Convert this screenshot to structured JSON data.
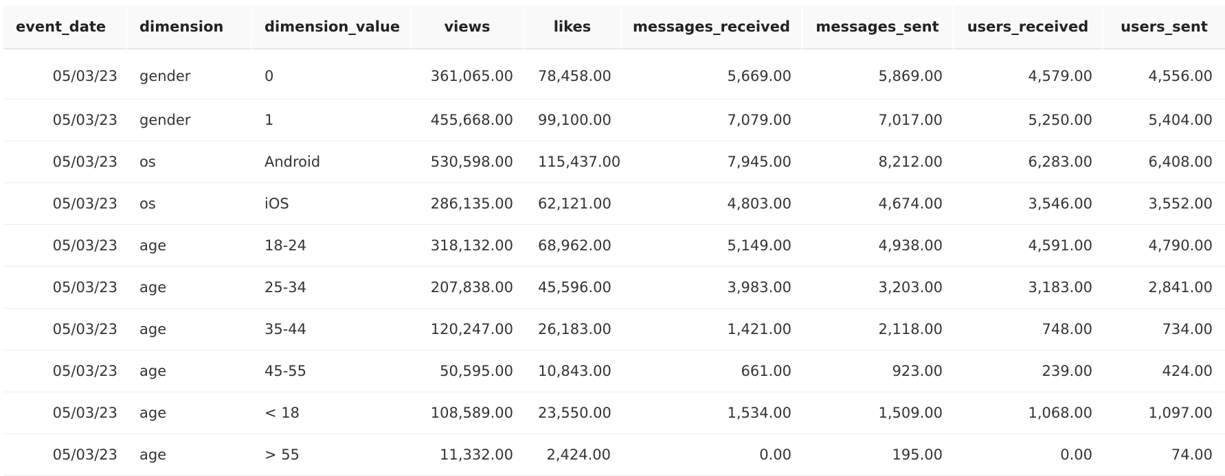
{
  "table": {
    "columns": [
      {
        "key": "event_date",
        "label": "event_date"
      },
      {
        "key": "dimension",
        "label": "dimension"
      },
      {
        "key": "dimension_value",
        "label": "dimension_value"
      },
      {
        "key": "views",
        "label": "views"
      },
      {
        "key": "likes",
        "label": "likes"
      },
      {
        "key": "messages_received",
        "label": "messages_received"
      },
      {
        "key": "messages_sent",
        "label": "messages_sent"
      },
      {
        "key": "users_received",
        "label": "users_received"
      },
      {
        "key": "users_sent",
        "label": "users_sent"
      }
    ],
    "rows": [
      [
        "05/03/23",
        "gender",
        "0",
        "361,065.00",
        "78,458.00",
        "5,669.00",
        "5,869.00",
        "4,579.00",
        "4,556.00"
      ],
      [
        "05/03/23",
        "gender",
        "1",
        "455,668.00",
        "99,100.00",
        "7,079.00",
        "7,017.00",
        "5,250.00",
        "5,404.00"
      ],
      [
        "05/03/23",
        "os",
        "Android",
        "530,598.00",
        "115,437.00",
        "7,945.00",
        "8,212.00",
        "6,283.00",
        "6,408.00"
      ],
      [
        "05/03/23",
        "os",
        "iOS",
        "286,135.00",
        "62,121.00",
        "4,803.00",
        "4,674.00",
        "3,546.00",
        "3,552.00"
      ],
      [
        "05/03/23",
        "age",
        "18-24",
        "318,132.00",
        "68,962.00",
        "5,149.00",
        "4,938.00",
        "4,591.00",
        "4,790.00"
      ],
      [
        "05/03/23",
        "age",
        "25-34",
        "207,838.00",
        "45,596.00",
        "3,983.00",
        "3,203.00",
        "3,183.00",
        "2,841.00"
      ],
      [
        "05/03/23",
        "age",
        "35-44",
        "120,247.00",
        "26,183.00",
        "1,421.00",
        "2,118.00",
        "748.00",
        "734.00"
      ],
      [
        "05/03/23",
        "age",
        "45-55",
        "50,595.00",
        "10,843.00",
        "661.00",
        "923.00",
        "239.00",
        "424.00"
      ],
      [
        "05/03/23",
        "age",
        "< 18",
        "108,589.00",
        "23,550.00",
        "1,534.00",
        "1,509.00",
        "1,068.00",
        "1,097.00"
      ],
      [
        "05/03/23",
        "age",
        "> 55",
        "11,332.00",
        "2,424.00",
        "0.00",
        "195.00",
        "0.00",
        "74.00"
      ]
    ]
  }
}
